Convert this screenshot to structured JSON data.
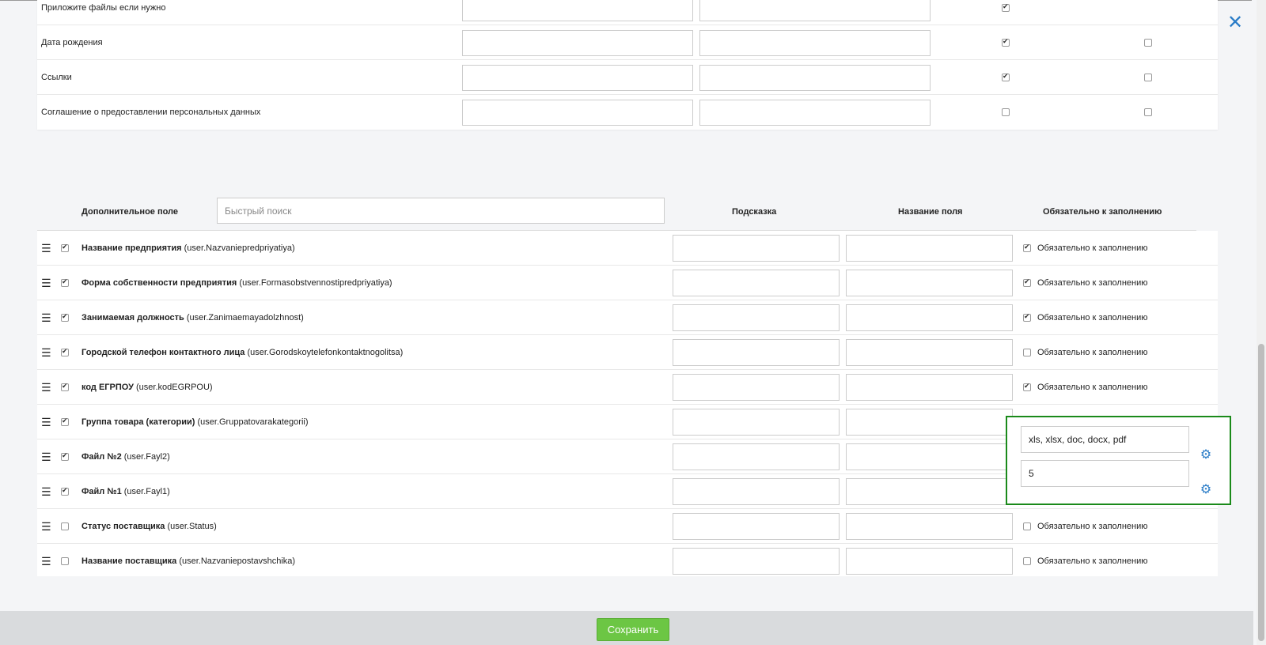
{
  "top_rows": [
    {
      "label": "Приложите файлы если нужно",
      "chk1": true,
      "chk2": null
    },
    {
      "label": "Дата рождения",
      "chk1": true,
      "chk2": false
    },
    {
      "label": "Ссылки",
      "chk1": true,
      "chk2": false
    },
    {
      "label": "Соглашение о предоставлении персональных данных",
      "chk1": false,
      "chk2": false
    }
  ],
  "header": {
    "extra_field": "Дополнительное поле",
    "search_placeholder": "Быстрый поиск",
    "hint": "Подсказка",
    "field_name": "Название поля",
    "required": "Обязательно к заполнению"
  },
  "rows": [
    {
      "enabled": true,
      "title": "Название предприятия",
      "code": "(user.Nazvaniepredpriyatiya)",
      "required": true,
      "required_label": "Обязательно к заполнению"
    },
    {
      "enabled": true,
      "title": "Форма собственности предприятия",
      "code": "(user.Formasobstvennostipredpriyatiya)",
      "required": true,
      "required_label": "Обязательно к заполнению"
    },
    {
      "enabled": true,
      "title": "Занимаемая должность",
      "code": "(user.Zanimaemayadolzhnost)",
      "required": true,
      "required_label": "Обязательно к заполнению"
    },
    {
      "enabled": true,
      "title": "Городской телефон контактного лица",
      "code": "(user.Gorodskoytelefonkontaktnogolitsa)",
      "required": false,
      "required_label": "Обязательно к заполнению"
    },
    {
      "enabled": true,
      "title": "код ЕГРПОУ",
      "code": "(user.kodEGRPOU)",
      "required": true,
      "required_label": "Обязательно к заполнению"
    },
    {
      "enabled": true,
      "title": "Группа товара (категории)",
      "code": "(user.Gruppatovarakategorii)",
      "required": null,
      "required_label": ""
    },
    {
      "enabled": true,
      "title": "Файл №2",
      "code": "(user.Fayl2)",
      "required": null,
      "required_label": ""
    },
    {
      "enabled": true,
      "title": "Файл №1",
      "code": "(user.Fayl1)",
      "required": null,
      "required_label": ""
    },
    {
      "enabled": false,
      "title": "Статус поставщика",
      "code": "(user.Status)",
      "required": false,
      "required_label": "Обязательно к заполнению"
    },
    {
      "enabled": false,
      "title": "Название поставщика",
      "code": "(user.Nazvaniepostavshchika)",
      "required": false,
      "required_label": "Обязательно к заполнению"
    }
  ],
  "file_settings": {
    "extensions": "xls, xlsx, doc, docx, pdf",
    "max_size": "5"
  },
  "footer": {
    "save_label": "Сохранить"
  },
  "colors": {
    "accent": "#2a7cc7",
    "save": "#6cc644",
    "highlight": "#1a8a1a"
  }
}
